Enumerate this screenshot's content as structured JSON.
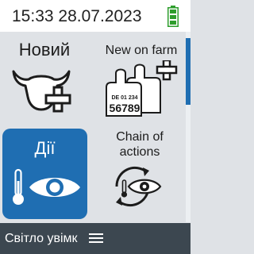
{
  "status": {
    "time": "15:33",
    "date": "28.07.2023",
    "battery_icon": "battery-full-icon",
    "battery_color": "#2e9d2c"
  },
  "tiles": [
    {
      "label": "Новий",
      "icon": "cow-head-plus-icon"
    },
    {
      "label": "New on farm",
      "icon": "ear-tags-plus-icon",
      "tag_lines": [
        "DE 01 234",
        "56789"
      ]
    },
    {
      "label": "Дії",
      "icon": "thermometer-eye-icon",
      "selected": true
    },
    {
      "label_lines": [
        "Chain of",
        "actions"
      ],
      "icon": "cycle-eye-icon"
    }
  ],
  "footer": {
    "label": "Світло увімк",
    "menu_icon": "hamburger-menu-icon"
  },
  "colors": {
    "accent": "#1f6eb2",
    "footer_bg": "#3c4750",
    "tile_bg": "#dfe2e6"
  }
}
